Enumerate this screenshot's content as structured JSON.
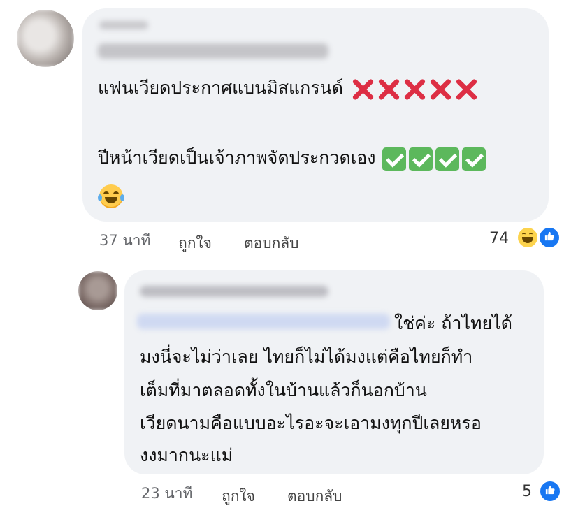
{
  "comments": [
    {
      "text_line1": "แฟนเวียดประกาศแบนมิสแกรนด์",
      "text_line2": "ปีหน้าเวียดเป็นเจ้าภาพจัดประกวดเอง",
      "emoji_line3": "laughing-crying-face",
      "time": "37 นาที",
      "like_label": "ถูกใจ",
      "reply_label": "ตอบกลับ",
      "reaction_count": "74",
      "reactions": [
        "haha-icon",
        "like-icon"
      ]
    },
    {
      "text_line1": "ใช่ค่ะ ถ้าไทยได้",
      "text_line2": "มงนี่จะไม่ว่าเลย ไทยก็ไม่ได้มงแต่คือไทยก็ทำ",
      "text_line3": "เต็มที่มาตลอดทั้งในบ้านแล้วก็นอกบ้าน",
      "text_line4": "เวียดนามคือแบบอะไรอะจะเอามงทุกปีเลยหรอ",
      "text_line5": "งงมากนะแม่",
      "time": "23 นาที",
      "like_label": "ถูกใจ",
      "reply_label": "ตอบกลับ",
      "reaction_count": "5",
      "reactions": [
        "like-icon"
      ]
    }
  ],
  "colors": {
    "bubble": "#f0f2f5",
    "meta": "#65676b",
    "like_blue": "#1877f2",
    "x_red": "#dd2e44",
    "check_green": "#5cb85c"
  }
}
